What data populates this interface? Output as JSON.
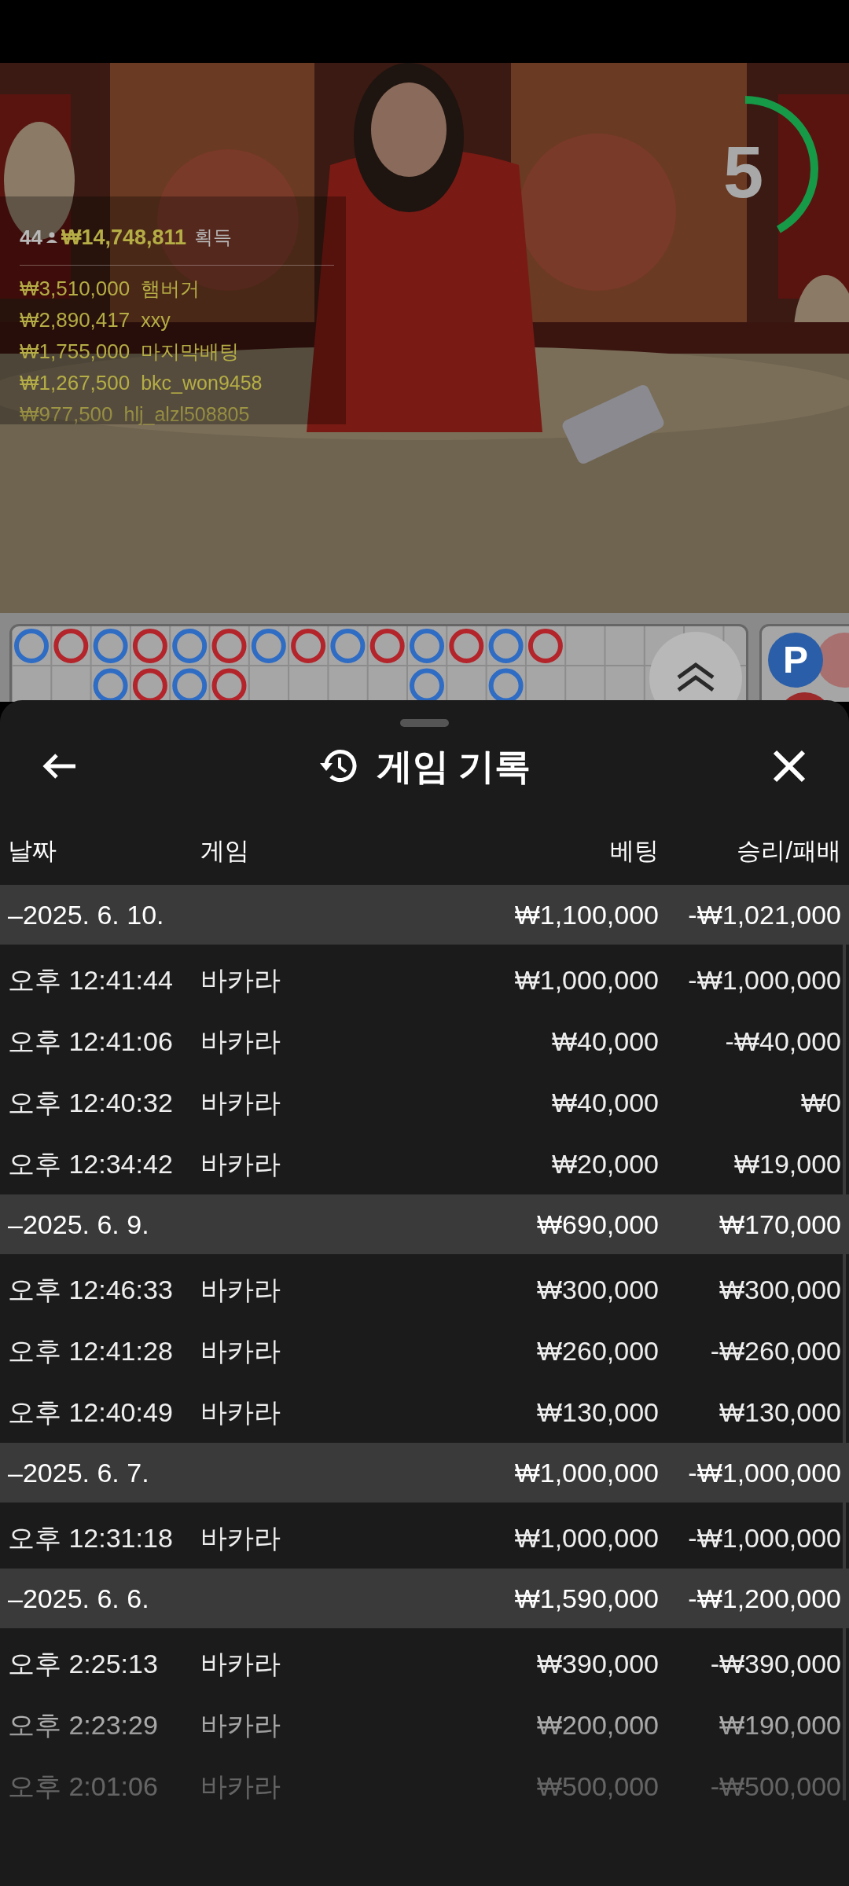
{
  "winners": {
    "player_count": "44",
    "total": "₩14,748,811",
    "total_label": "획득",
    "entries": [
      {
        "amount": "₩3,510,000",
        "name": "햄버거"
      },
      {
        "amount": "₩2,890,417",
        "name": "xxy"
      },
      {
        "amount": "₩1,755,000",
        "name": "마지막배팅"
      },
      {
        "amount": "₩1,267,500",
        "name": "bkc_won9458"
      },
      {
        "amount": "₩977,500",
        "name": "hlj_alzl508805"
      }
    ]
  },
  "timer": {
    "count": "5",
    "level": 0.42
  },
  "bead_road": {
    "columns": [
      [
        {
          "color": "#2f6cc4"
        }
      ],
      [
        {
          "color": "#b3252b"
        }
      ],
      [
        {
          "color": "#2f6cc4"
        },
        {
          "color": "#2f6cc4"
        }
      ],
      [
        {
          "color": "#b3252b"
        },
        {
          "color": "#b3252b"
        }
      ],
      [
        {
          "color": "#2f6cc4"
        },
        {
          "color": "#2f6cc4"
        }
      ],
      [
        {
          "color": "#b3252b"
        },
        {
          "color": "#b3252b"
        }
      ],
      [
        {
          "color": "#2f6cc4"
        }
      ],
      [
        {
          "color": "#b3252b"
        }
      ],
      [
        {
          "color": "#2f6cc4"
        }
      ],
      [
        {
          "color": "#b3252b"
        }
      ],
      [
        {
          "color": "#2f6cc4"
        },
        {
          "color": "#2f6cc4"
        }
      ],
      [
        {
          "color": "#b3252b"
        }
      ],
      [
        {
          "color": "#2f6cc4"
        },
        {
          "color": "#2f6cc4"
        }
      ],
      [
        {
          "color": "#b3252b"
        }
      ]
    ]
  },
  "side_panel": {
    "label": "P"
  },
  "sheet": {
    "title": "게임 기록",
    "columns": [
      "날짜",
      "게임",
      "베팅",
      "승리/패배"
    ],
    "groups": [
      {
        "date": "–2025. 6. 10.",
        "bet": "₩1,100,000",
        "result": "-₩1,021,000",
        "rows": [
          {
            "time": "오후 12:41:44",
            "game": "바카라",
            "bet": "₩1,000,000",
            "result": "-₩1,000,000"
          },
          {
            "time": "오후 12:41:06",
            "game": "바카라",
            "bet": "₩40,000",
            "result": "-₩40,000"
          },
          {
            "time": "오후 12:40:32",
            "game": "바카라",
            "bet": "₩40,000",
            "result": "₩0"
          },
          {
            "time": "오후 12:34:42",
            "game": "바카라",
            "bet": "₩20,000",
            "result": "₩19,000"
          }
        ]
      },
      {
        "date": "–2025. 6. 9.",
        "bet": "₩690,000",
        "result": "₩170,000",
        "rows": [
          {
            "time": "오후 12:46:33",
            "game": "바카라",
            "bet": "₩300,000",
            "result": "₩300,000"
          },
          {
            "time": "오후 12:41:28",
            "game": "바카라",
            "bet": "₩260,000",
            "result": "-₩260,000"
          },
          {
            "time": "오후 12:40:49",
            "game": "바카라",
            "bet": "₩130,000",
            "result": "₩130,000"
          }
        ]
      },
      {
        "date": "–2025. 6. 7.",
        "bet": "₩1,000,000",
        "result": "-₩1,000,000",
        "rows": [
          {
            "time": "오후 12:31:18",
            "game": "바카라",
            "bet": "₩1,000,000",
            "result": "-₩1,000,000"
          }
        ]
      },
      {
        "date": "–2025. 6. 6.",
        "bet": "₩1,590,000",
        "result": "-₩1,200,000",
        "rows": [
          {
            "time": "오후 2:25:13",
            "game": "바카라",
            "bet": "₩390,000",
            "result": "-₩390,000"
          },
          {
            "time": "오후 2:23:29",
            "game": "바카라",
            "bet": "₩200,000",
            "result": "₩190,000"
          },
          {
            "time": "오후 2:01:06",
            "game": "바카라",
            "bet": "₩500,000",
            "result": "-₩500,000"
          }
        ]
      }
    ]
  }
}
